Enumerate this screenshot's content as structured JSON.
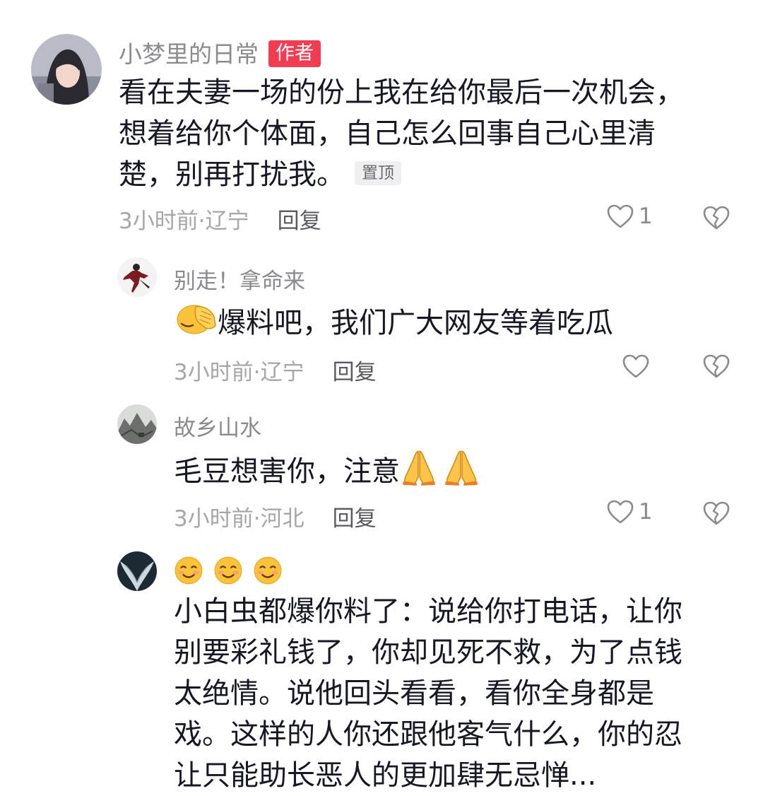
{
  "comments": [
    {
      "author": "小梦里的日常",
      "badge": "作者",
      "text_lines": [
        "看在夫妻一场的份上我在给你最后一次机会，",
        "想着给你个体面，自己怎么回事自己心里清",
        "楚，别再打扰我。"
      ],
      "pin_label": "置顶",
      "meta": "3小时前·辽宁",
      "reply_label": "回复",
      "like_count": "1"
    },
    {
      "author": "别走！拿命来",
      "text": "爆料吧，我们广大网友等着吃瓜",
      "meta": "3小时前·辽宁",
      "reply_label": "回复",
      "like_count": ""
    },
    {
      "author": "故乡山水",
      "text": "毛豆想害你，注意",
      "meta": "3小时前·河北",
      "reply_label": "回复",
      "like_count": "1"
    },
    {
      "author": "",
      "text_lines": [
        "小白虫都爆你料了：说给你打电话，让你",
        "别要彩礼钱了，你却见死不救，为了点钱",
        "太绝情。说他回头看看，看你全身都是",
        "戏。这样的人你还跟他客气什么，你的忍",
        "让只能助长恶人的更加肆无忌惮..."
      ]
    }
  ],
  "icons": {
    "like": "heart-outline-icon",
    "dislike": "broken-heart-icon",
    "facepalm": "facepalm-emoji",
    "pray": "folded-hands-emoji",
    "smile": "smiling-face-emoji"
  }
}
